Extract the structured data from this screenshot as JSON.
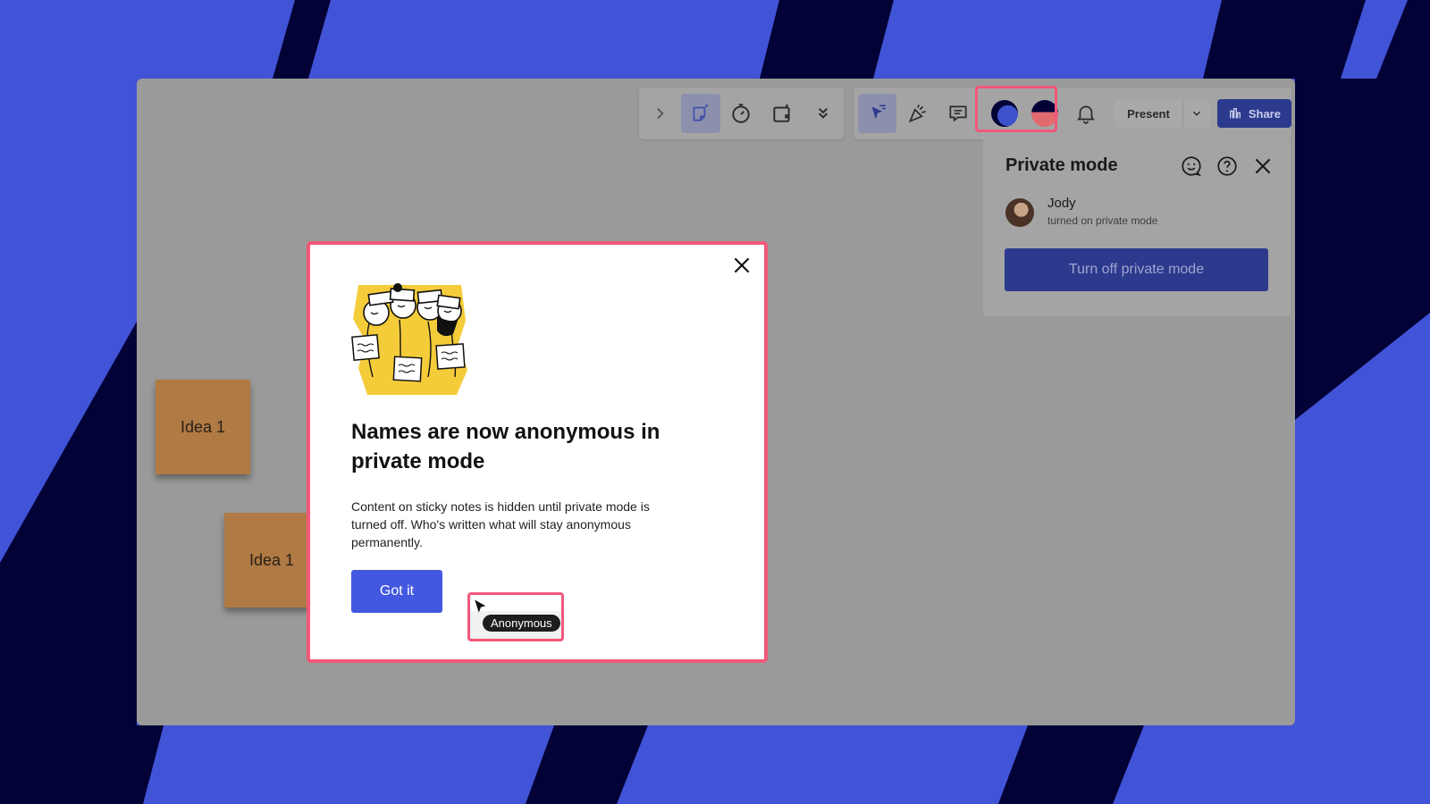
{
  "background": {
    "base_color": "#4153d6",
    "stripe_color": "#030237"
  },
  "board": {
    "sticky_notes": [
      {
        "label": "Idea 1"
      },
      {
        "label": "Idea 1"
      }
    ]
  },
  "toolbar": {
    "left_group": [
      {
        "icon": "chevron-right-icon"
      },
      {
        "icon": "sticky-note-tool-icon",
        "active": true
      },
      {
        "icon": "timer-icon"
      },
      {
        "icon": "frame-tool-icon"
      },
      {
        "icon": "double-chevron-down-icon"
      }
    ],
    "right_group": [
      {
        "icon": "cursor-select-icon",
        "active": true
      },
      {
        "icon": "reactions-icon"
      },
      {
        "icon": "comments-icon"
      },
      {
        "icon": "private-mode-avatar-icon"
      },
      {
        "icon": "anonymous-avatar-icon"
      },
      {
        "icon": "bell-icon"
      }
    ],
    "present_label": "Present",
    "share_label": "Share",
    "highlight_color": "#f2587a"
  },
  "panel": {
    "title": "Private mode",
    "user_name": "Jody",
    "user_status": "turned on private mode",
    "button_label": "Turn off private mode"
  },
  "modal": {
    "title": "Names are now anonymous in private mode",
    "body": "Content on sticky notes is hidden until private mode is turned off. Who's written what will stay anonymous permanently.",
    "button_label": "Got it",
    "cursor_tag": "Anonymous"
  }
}
